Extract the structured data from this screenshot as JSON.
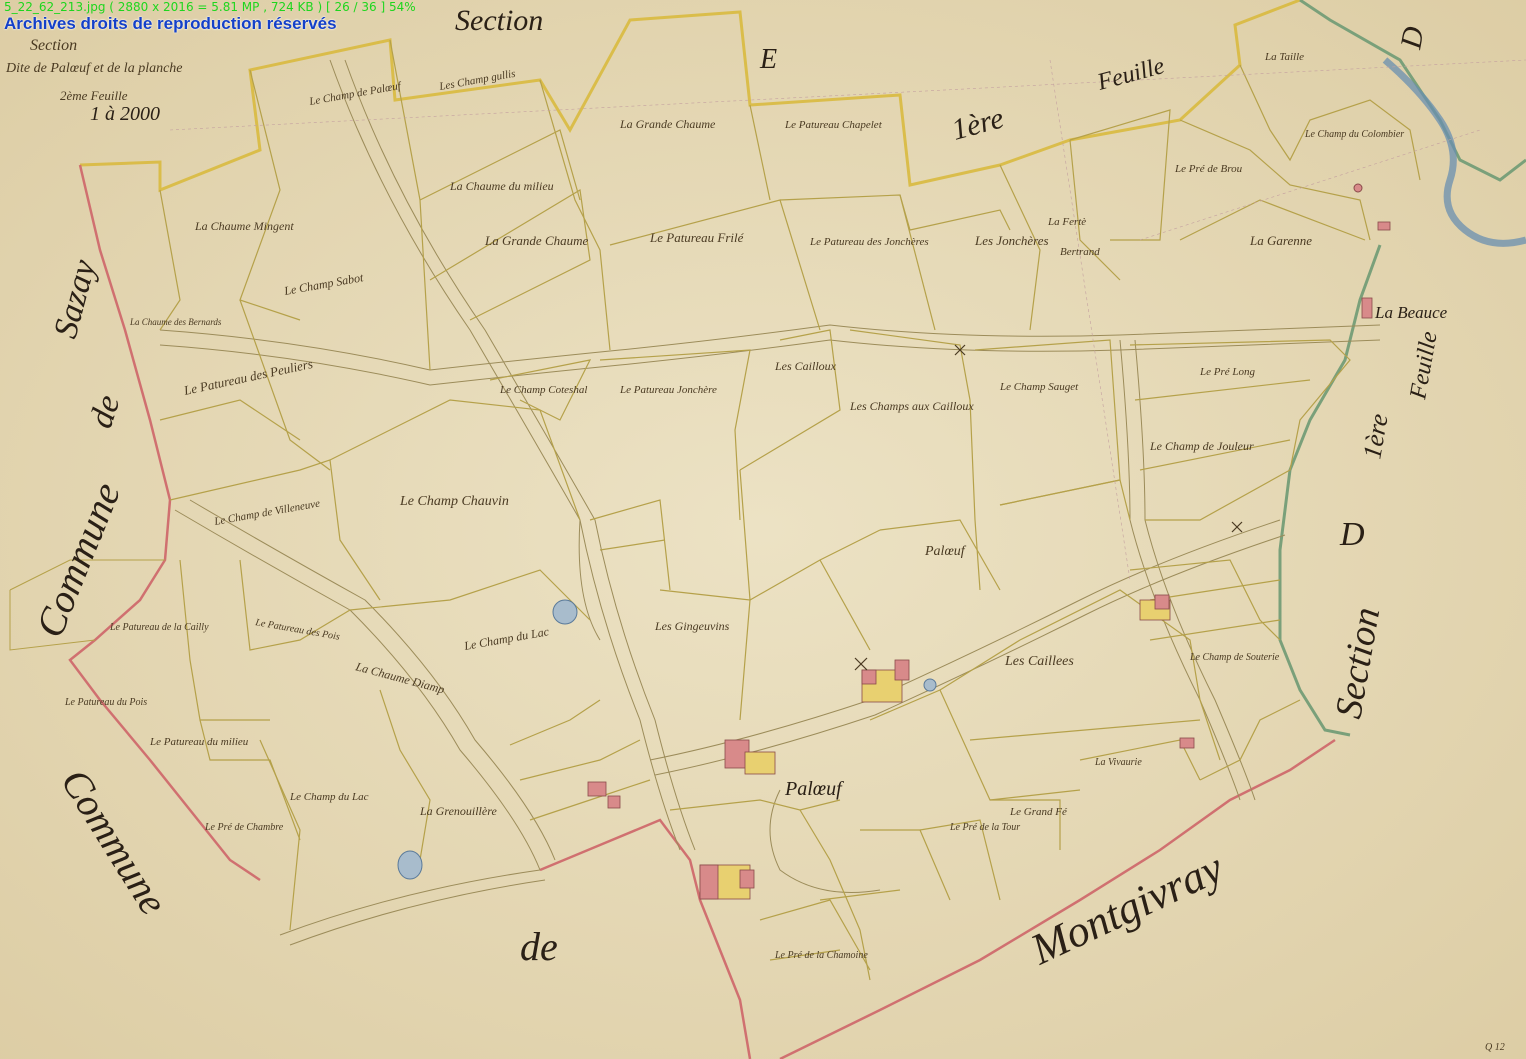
{
  "viewer": {
    "info_line": "5_22_62_213.jpg ( 2880 x 2016 = 5.81 MP , 724 KB ) [ 26 / 36 ] 54%",
    "rights_notice": "Archives droits de reproduction réservés"
  },
  "map": {
    "header": {
      "section_word": "Section",
      "title": "Dite de Palœuf et de la planche",
      "subtitle": "2ème Feuille",
      "scale": "1 à 2000"
    },
    "sections": {
      "top_section": "Section",
      "letter_e": "E",
      "letter_d": "D",
      "right_section": "Section",
      "first_sheet": "1ère",
      "sheet_word": "Feuille",
      "feuille_right": "Feuille",
      "first_right": "1ère"
    },
    "communes": {
      "left": "Commune de Sazay",
      "left_word1": "Commune",
      "left_word2": "de",
      "left_word3": "Sazay",
      "bottom_word1": "Commune",
      "bottom_word2": "de",
      "bottom_word3": "Montgivray"
    },
    "places": {
      "palœuf": "Palœuf",
      "la_beauce": "La Beauce"
    },
    "parcels": [
      "Le Champ de Palœuf",
      "Les Champ gullis",
      "La Grande Chaume",
      "Le Patureau Chapelet",
      "La Chaume du milieu",
      "La Chaume Mingent",
      "Le Champ Sabot",
      "La Grande Chaume",
      "Le Patureau Frilé",
      "Le Patureau des Jonchères",
      "Les Jonchères",
      "La Garenne",
      "Le Pré de Brou",
      "Le Champ du Colombier",
      "Le Patureau des Peuliers",
      "Le Champ Coteshal",
      "Le Patureau Jonchère",
      "Les Cailloux",
      "Les Champs aux Cailloux",
      "Le Champ Sauget",
      "Le Pré Long",
      "Le Champ de Jouleur",
      "Le Champ de Villeneuve",
      "Le Champ Chauvin",
      "Palœuf",
      "Le Patureau de la Cailly",
      "Le Patureau des Pois",
      "La Chaume Diamp",
      "Le Champ du Lac",
      "Les Gingeuvins",
      "Les Caillees",
      "Le Champ de Souterie",
      "Le Patureau du Pois",
      "Le Patureau du milieu",
      "Le Champ du Lac",
      "La Grenouillère",
      "Le Pré de Chambre",
      "La Vivaurie",
      "Le Grand Fé",
      "Le Pré de la Tour",
      "Le Pré de la Chamoine",
      "La Fertè",
      "Bertrand",
      "La Taille",
      "La Chaume des Bernards"
    ],
    "corner_code": "Q 12"
  },
  "colors": {
    "paper": "#e8dcb9",
    "parcel_line": "#b5a14a",
    "section_border": "#d8b938",
    "commune_border": "#d07070",
    "road": "#d9cda8",
    "water": "#6a8fb0",
    "buildings": "#d88a8a",
    "buildings_yellow": "#e8d070",
    "river_green": "#7aa07a"
  }
}
